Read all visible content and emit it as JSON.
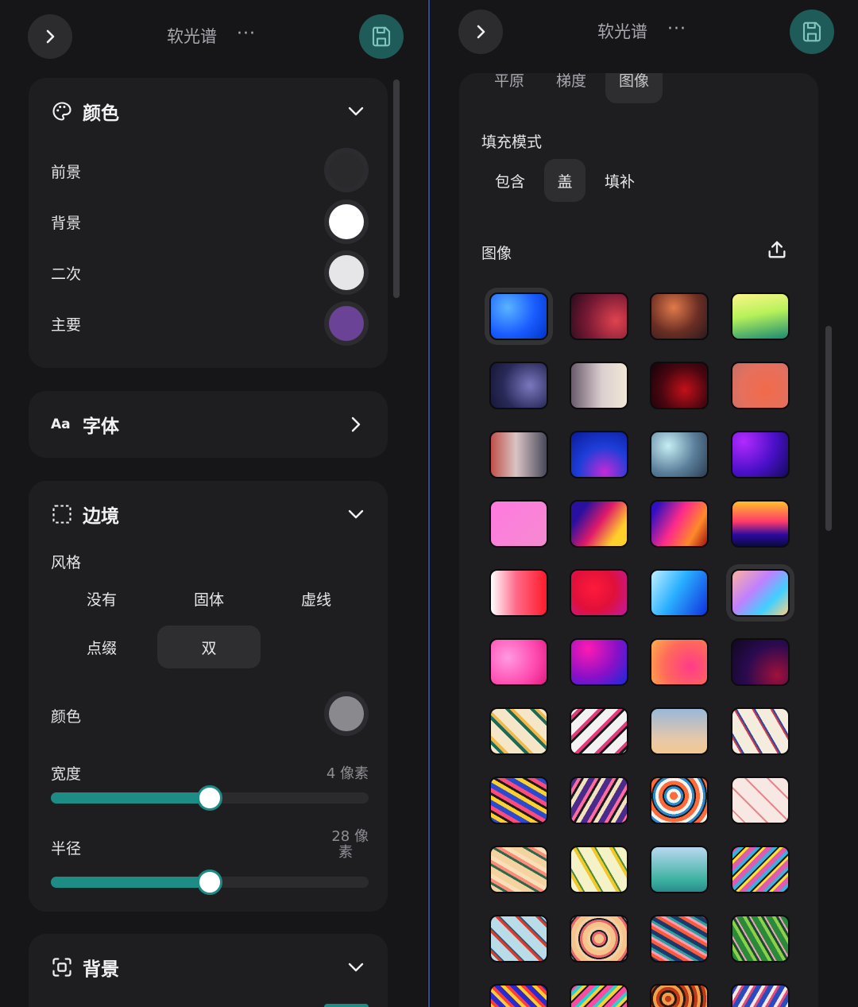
{
  "left": {
    "app_title": "软光谱",
    "more_icon_text": "···",
    "color_section": {
      "title": "颜色",
      "rows": [
        {
          "label": "前景",
          "color": "#2a2a2d"
        },
        {
          "label": "背景",
          "color": "#ffffff"
        },
        {
          "label": "二次",
          "color": "#e6e6e8"
        },
        {
          "label": "主要",
          "color": "#6a4396"
        }
      ]
    },
    "font_section": {
      "title": "字体",
      "icon_text": "Aa"
    },
    "border_section": {
      "title": "边境",
      "style_label": "风格",
      "style_options": [
        "没有",
        "固体",
        "虚线",
        "点缀",
        "双"
      ],
      "selected_style": "双",
      "color_label": "颜色",
      "color_value": "#8a8a8e",
      "width_label": "宽度",
      "width_value": "4 像素",
      "width_fraction": 0.5,
      "radius_label": "半径",
      "radius_value_line1": "28 像",
      "radius_value_line2": "素",
      "radius_fraction": 0.5
    },
    "background_section": {
      "title": "背景"
    }
  },
  "right": {
    "app_title": "软光谱",
    "more_icon_text": "···",
    "bg_type_tabs": [
      "平原",
      "梯度",
      "图像"
    ],
    "selected_bg_type": "图像",
    "fill_mode_label": "填充模式",
    "fill_modes": [
      "包含",
      "盖",
      "填补"
    ],
    "selected_fill_mode": "盖",
    "image_label": "图像",
    "selected_tile_indices": [
      0,
      19
    ]
  },
  "colors": {
    "accent_teal": "#1c8c85",
    "save_button_bg": "#1f5b58",
    "card_bg": "#1e1e21",
    "page_bg": "#161618"
  }
}
